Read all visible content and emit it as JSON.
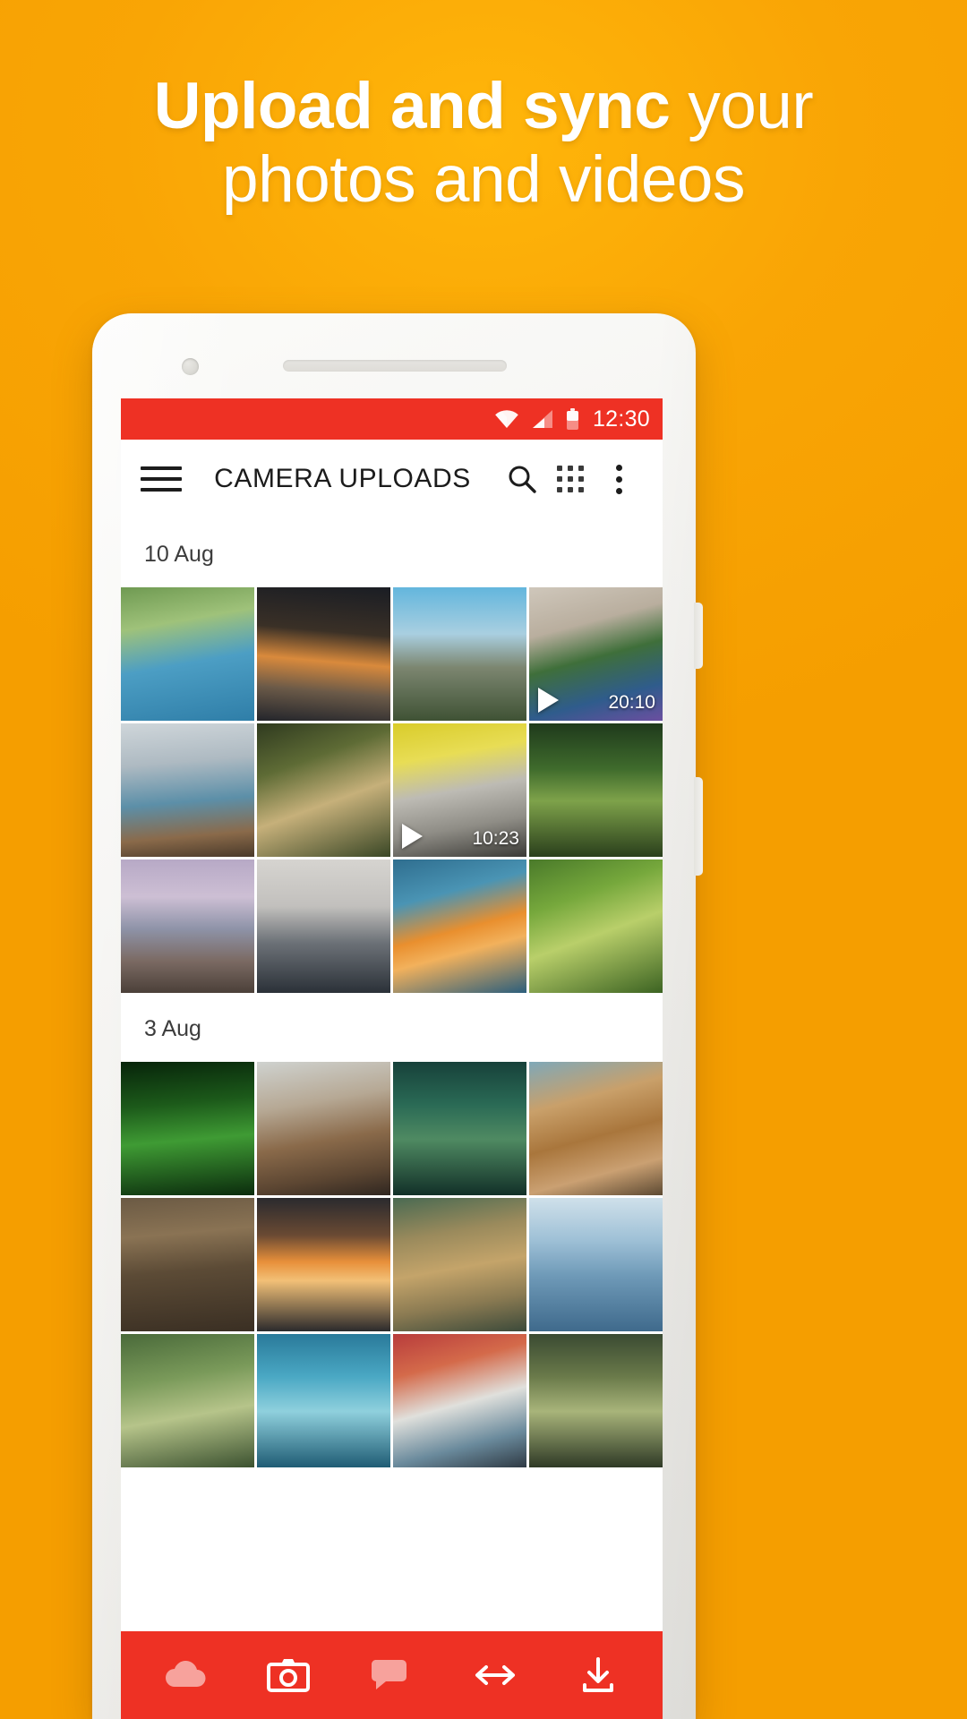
{
  "promo": {
    "background_color": "#f5a700",
    "headline_bold": "Upload and sync",
    "headline_regular": " your",
    "headline_line2": "photos and videos"
  },
  "phone": {
    "status_bar": {
      "background_color": "#ee3124",
      "time": "12:30",
      "icons": [
        "wifi-icon",
        "cellular-signal-icon",
        "battery-icon"
      ]
    },
    "app_bar": {
      "title": "CAMERA UPLOADS",
      "menu_icon": "hamburger-menu-icon",
      "search_icon": "search-icon",
      "grid_icon": "grid-view-icon",
      "overflow_icon": "overflow-menu-icon"
    },
    "gallery": {
      "sections": [
        {
          "date": "10 Aug",
          "items": [
            {
              "art": "a1",
              "type": "photo"
            },
            {
              "art": "a2",
              "type": "photo"
            },
            {
              "art": "a3",
              "type": "photo"
            },
            {
              "art": "a4",
              "type": "video",
              "duration": "20:10"
            },
            {
              "art": "a5",
              "type": "photo"
            },
            {
              "art": "a6",
              "type": "photo"
            },
            {
              "art": "a7",
              "type": "video",
              "duration": "10:23"
            },
            {
              "art": "a8",
              "type": "photo"
            },
            {
              "art": "a9",
              "type": "photo"
            },
            {
              "art": "a10",
              "type": "photo"
            },
            {
              "art": "a11",
              "type": "photo"
            },
            {
              "art": "a12",
              "type": "photo"
            }
          ]
        },
        {
          "date": "3 Aug",
          "items": [
            {
              "art": "a13",
              "type": "photo"
            },
            {
              "art": "a14",
              "type": "photo"
            },
            {
              "art": "a15",
              "type": "photo"
            },
            {
              "art": "a16",
              "type": "photo"
            },
            {
              "art": "a17",
              "type": "photo"
            },
            {
              "art": "a18",
              "type": "photo"
            },
            {
              "art": "a19",
              "type": "photo"
            },
            {
              "art": "a20",
              "type": "photo"
            },
            {
              "art": "a21",
              "type": "photo"
            },
            {
              "art": "a22",
              "type": "photo"
            },
            {
              "art": "a23",
              "type": "photo"
            },
            {
              "art": "a24",
              "type": "photo"
            }
          ]
        }
      ]
    },
    "bottom_nav": {
      "background_color": "#ee3124",
      "items": [
        {
          "icon": "cloud-drive-icon",
          "label": "Cloud Drive"
        },
        {
          "icon": "camera-uploads-icon",
          "label": "Camera Uploads"
        },
        {
          "icon": "chat-icon",
          "label": "Chat"
        },
        {
          "icon": "transfers-icon",
          "label": "Transfers"
        },
        {
          "icon": "download-icon",
          "label": "Offline"
        }
      ]
    }
  }
}
